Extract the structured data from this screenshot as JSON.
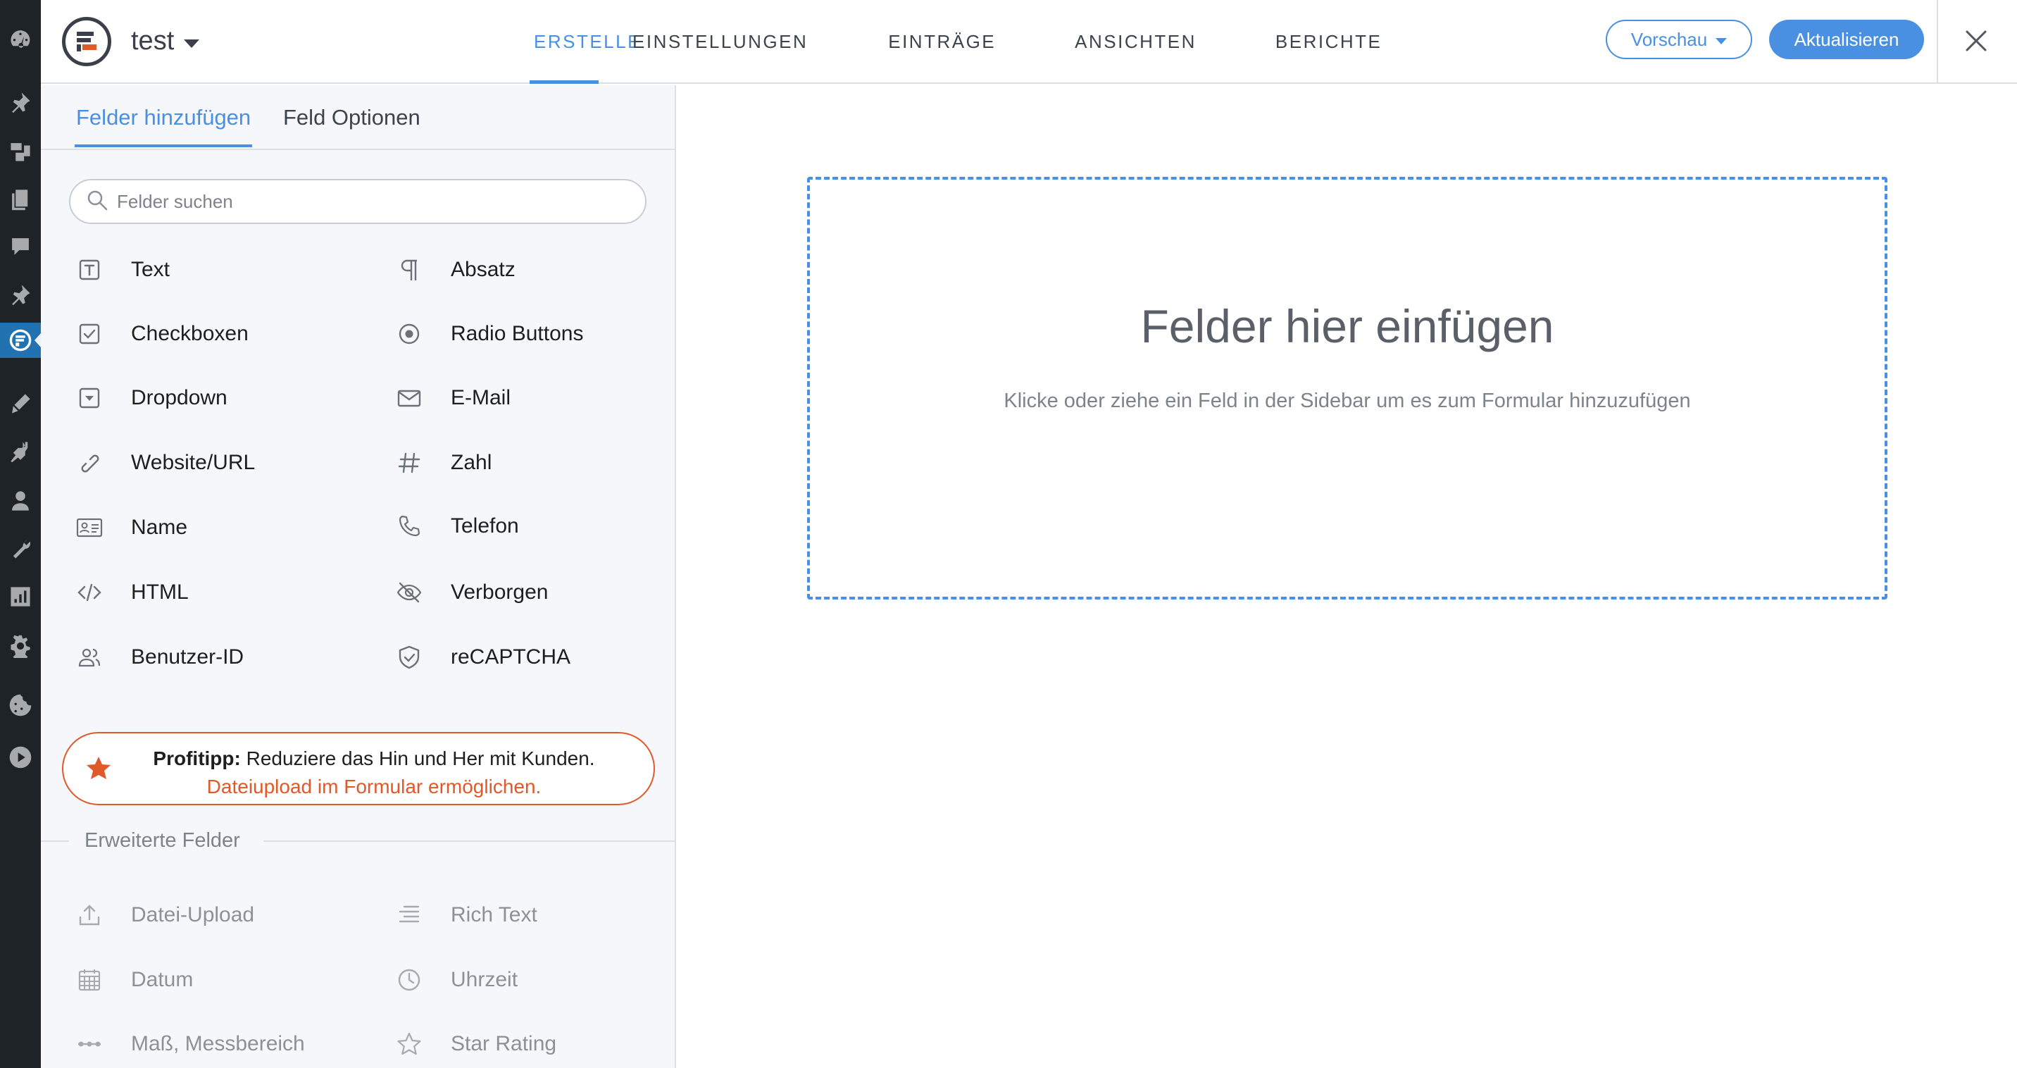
{
  "header": {
    "form_title": "test",
    "tabs": [
      {
        "label": "ERSTELLE",
        "active": true
      },
      {
        "label": "EINSTELLUNGEN",
        "active": false
      },
      {
        "label": "EINTRÄGE",
        "active": false
      },
      {
        "label": "ANSICHTEN",
        "active": false
      },
      {
        "label": "BERICHTE",
        "active": false
      }
    ],
    "preview_label": "Vorschau",
    "update_label": "Aktualisieren"
  },
  "sidebar": {
    "tabs": [
      {
        "label": "Felder hinzufügen",
        "active": true
      },
      {
        "label": "Feld Optionen",
        "active": false
      }
    ],
    "search_placeholder": "Felder suchen",
    "fields": [
      {
        "label": "Text",
        "icon": "text-icon"
      },
      {
        "label": "Absatz",
        "icon": "paragraph-icon"
      },
      {
        "label": "Checkboxen",
        "icon": "checkbox-icon"
      },
      {
        "label": "Radio Buttons",
        "icon": "radio-icon"
      },
      {
        "label": "Dropdown",
        "icon": "dropdown-icon"
      },
      {
        "label": "E-Mail",
        "icon": "envelope-icon"
      },
      {
        "label": "Website/URL",
        "icon": "link-icon"
      },
      {
        "label": "Zahl",
        "icon": "hash-icon"
      },
      {
        "label": "Name",
        "icon": "id-card-icon"
      },
      {
        "label": "Telefon",
        "icon": "phone-icon"
      },
      {
        "label": "HTML",
        "icon": "code-icon"
      },
      {
        "label": "Verborgen",
        "icon": "eye-slash-icon"
      },
      {
        "label": "Benutzer-ID",
        "icon": "users-icon"
      },
      {
        "label": "reCAPTCHA",
        "icon": "shield-check-icon"
      }
    ],
    "tip": {
      "bold": "Profitipp:",
      "text": " Reduziere das Hin und Her mit Kunden.",
      "link": "Dateiupload im Formular ermöglichen."
    },
    "advanced_section_label": "Erweiterte Felder",
    "advanced_fields": [
      {
        "label": "Datei-Upload",
        "icon": "upload-icon"
      },
      {
        "label": "Rich Text",
        "icon": "rich-text-icon"
      },
      {
        "label": "Datum",
        "icon": "calendar-icon"
      },
      {
        "label": "Uhrzeit",
        "icon": "clock-icon"
      },
      {
        "label": "Maß, Messbereich",
        "icon": "slider-icon"
      },
      {
        "label": "Star Rating",
        "icon": "star-icon"
      }
    ]
  },
  "canvas": {
    "title": "Felder hier einfügen",
    "subtitle": "Klicke oder ziehe ein Feld in der Sidebar um es zum Formular hinzuzufügen"
  },
  "colors": {
    "accent": "#4a90e2",
    "tip": "#e0592a",
    "wp_sidebar": "#1d2327"
  }
}
